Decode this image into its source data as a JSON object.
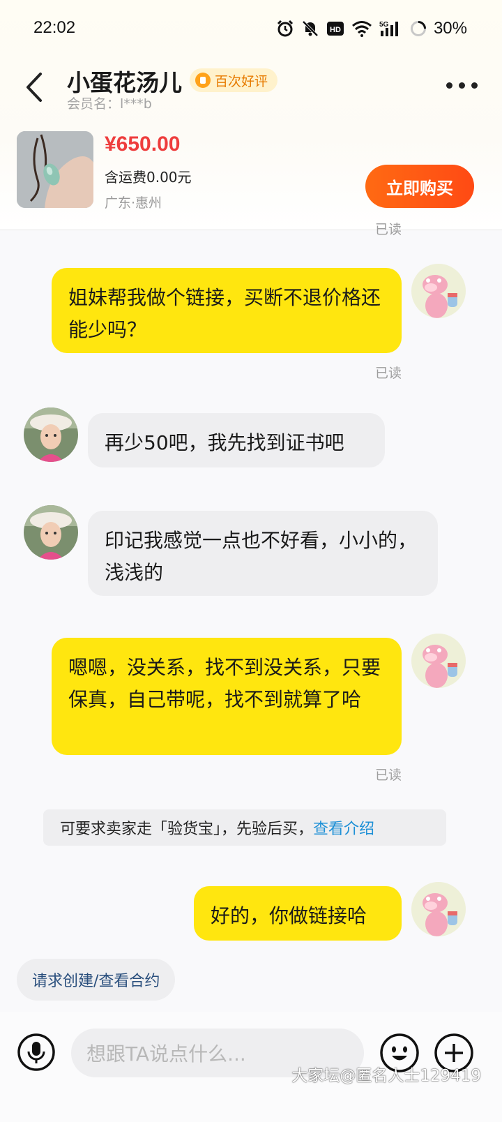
{
  "status_bar": {
    "time": "22:02",
    "battery": "30%",
    "icons": [
      "alarm-icon",
      "mute-icon",
      "hd-icon",
      "wifi-icon",
      "5g-signal-icon",
      "battery-icon"
    ]
  },
  "header": {
    "seller_name": "小蛋花汤儿",
    "badge": "百次好评",
    "member_label": "会员名：l***b"
  },
  "product": {
    "price": "¥650.00",
    "shipping": "含运费0.00元",
    "location": "广东·惠州",
    "buy_label": "立即购买"
  },
  "messages": [
    {
      "sender": "me",
      "text": "姐妹帮我做个链接，买断不退价格还能少吗？",
      "status": "已读"
    },
    {
      "sender": "seller",
      "text": "再少50吧，我先找到证书吧"
    },
    {
      "sender": "seller",
      "text": "印记我感觉一点也不好看，小小的，浅浅的"
    },
    {
      "sender": "me",
      "text": "嗯嗯，没关系，找不到没关系，只要保真，自己带呢，找不到就算了哈",
      "status": "已读"
    },
    {
      "sender": "me",
      "text": "好的，你做链接哈"
    }
  ],
  "top_read_status": "已读",
  "notice": {
    "text": "可要求卖家走「验货宝」，先验后买，",
    "link": "查看介绍"
  },
  "contract_button": "请求创建/查看合约",
  "input": {
    "placeholder": "想跟TA说点什么..."
  },
  "watermark": "大家坛@匿名人士129419",
  "colors": {
    "my_bubble": "#ffe60f",
    "their_bubble": "#eeeef0",
    "price": "#ee3d3d",
    "buy_button": "#ff5514",
    "link": "#1e90d6"
  }
}
